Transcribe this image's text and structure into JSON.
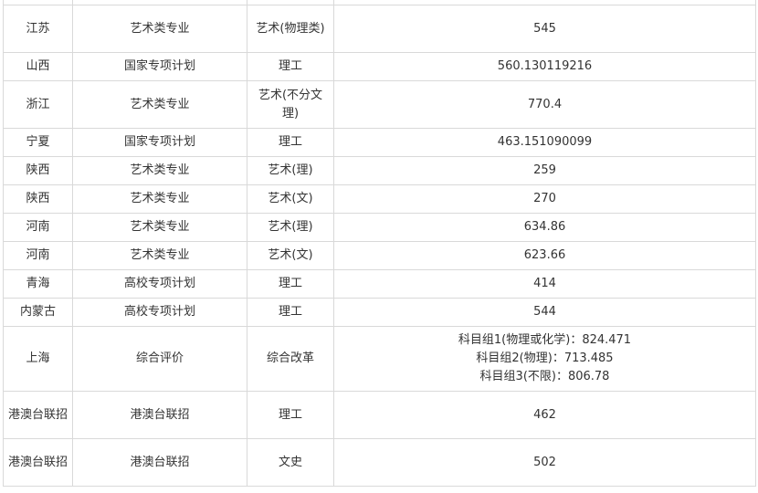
{
  "table": {
    "top_row": [
      "",
      "",
      "",
      ""
    ],
    "rows": [
      {
        "province": "江苏",
        "batch": "艺术类专业",
        "category": "艺术(物理类)",
        "score": [
          "545"
        ]
      },
      {
        "province": "山西",
        "batch": "国家专项计划",
        "category": "理工",
        "score": [
          "560.130119216"
        ]
      },
      {
        "province": "浙江",
        "batch": "艺术类专业",
        "category": "艺术(不分文理)",
        "score": [
          "770.4"
        ]
      },
      {
        "province": "宁夏",
        "batch": "国家专项计划",
        "category": "理工",
        "score": [
          "463.151090099"
        ]
      },
      {
        "province": "陕西",
        "batch": "艺术类专业",
        "category": "艺术(理)",
        "score": [
          "259"
        ]
      },
      {
        "province": "陕西",
        "batch": "艺术类专业",
        "category": "艺术(文)",
        "score": [
          "270"
        ]
      },
      {
        "province": "河南",
        "batch": "艺术类专业",
        "category": "艺术(理)",
        "score": [
          "634.86"
        ]
      },
      {
        "province": "河南",
        "batch": "艺术类专业",
        "category": "艺术(文)",
        "score": [
          "623.66"
        ]
      },
      {
        "province": "青海",
        "batch": "高校专项计划",
        "category": "理工",
        "score": [
          "414"
        ]
      },
      {
        "province": "内蒙古",
        "batch": "高校专项计划",
        "category": "理工",
        "score": [
          "544"
        ]
      },
      {
        "province": "上海",
        "batch": "综合评价",
        "category": "综合改革",
        "score": [
          "科目组1(物理或化学)：824.471",
          "科目组2(物理)：713.485",
          "科目组3(不限)：806.78"
        ]
      },
      {
        "province": "港澳台联招",
        "batch": "港澳台联招",
        "category": "理工",
        "score": [
          "462"
        ]
      },
      {
        "province": "港澳台联招",
        "batch": "港澳台联招",
        "category": "文史",
        "score": [
          "502"
        ]
      }
    ]
  }
}
